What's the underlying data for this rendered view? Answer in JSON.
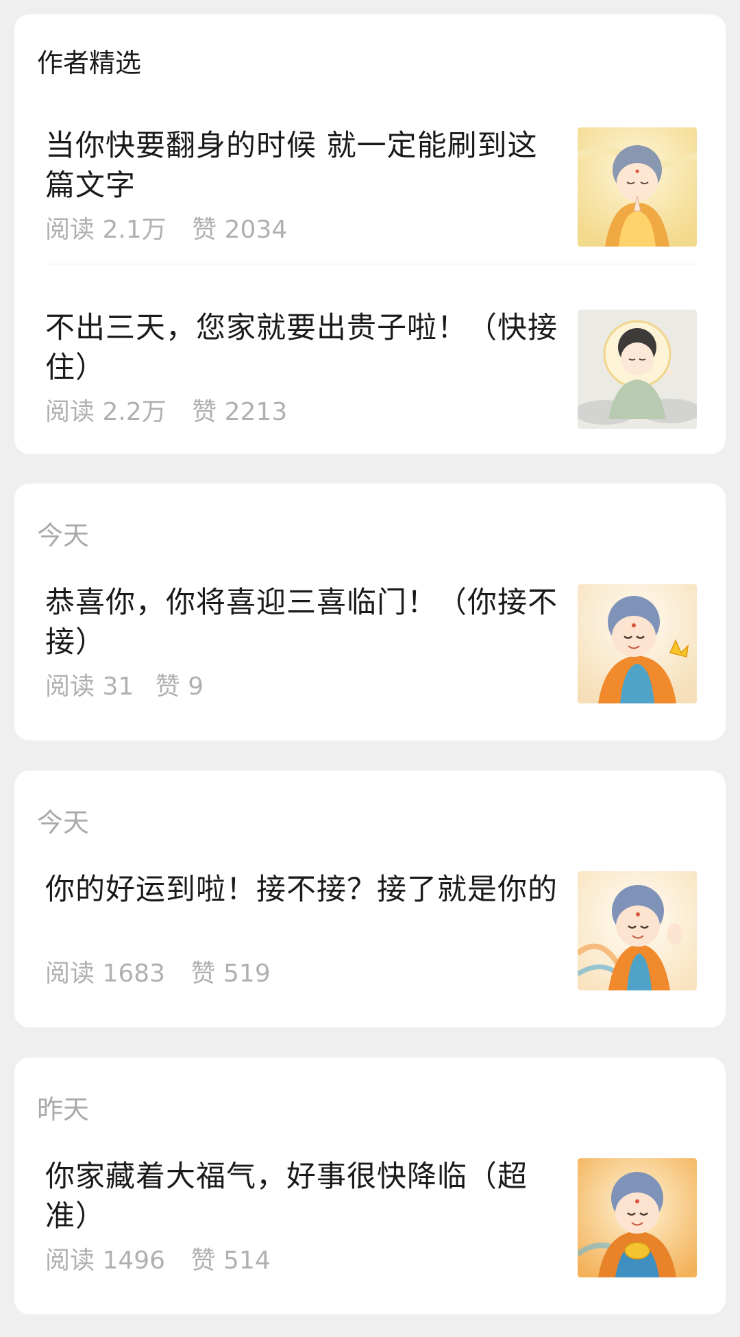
{
  "featured": {
    "header": "作者精选",
    "articles": [
      {
        "title": "当你快要翻身的时候 就一定能刷到这篇文字",
        "reads_label": "阅读",
        "reads": "2.1万",
        "likes_label": "赞",
        "likes": "2034",
        "thumb": "praying-child-buddha-icon"
      },
      {
        "title": "不出三天，您家就要出贵子啦！（快接住）",
        "reads_label": "阅读",
        "reads": "2.2万",
        "likes_label": "赞",
        "likes": "2213",
        "thumb": "meditating-buddha-icon"
      }
    ]
  },
  "feed": [
    {
      "date": "今天",
      "article": {
        "title": "恭喜你，你将喜迎三喜临门！（你接不接）",
        "reads_label": "阅读",
        "reads": "31",
        "likes_label": "赞",
        "likes": "9",
        "thumb": "buddha-with-lotus-icon"
      }
    },
    {
      "date": "今天",
      "article": {
        "title": "你的好运到啦！接不接？接了就是你的",
        "reads_label": "阅读",
        "reads": "1683",
        "likes_label": "赞",
        "likes": "519",
        "thumb": "waving-buddha-icon"
      }
    },
    {
      "date": "昨天",
      "article": {
        "title": "你家藏着大福气，好事很快降临（超准）",
        "reads_label": "阅读",
        "reads": "1496",
        "likes_label": "赞",
        "likes": "514",
        "thumb": "buddha-with-treasure-icon"
      }
    }
  ]
}
